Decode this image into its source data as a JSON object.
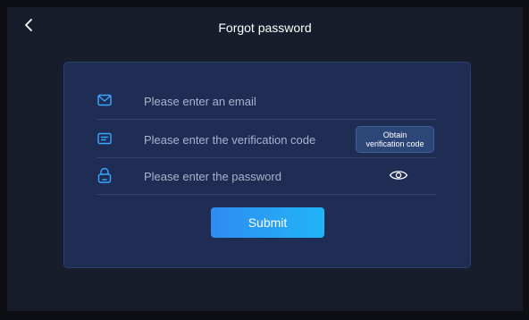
{
  "header": {
    "title": "Forgot password",
    "back_icon": "chevron-left-icon"
  },
  "form": {
    "email": {
      "icon": "mail-icon",
      "placeholder": "Please enter an email",
      "value": ""
    },
    "verification": {
      "icon": "message-icon",
      "placeholder": "Please enter the verification code",
      "value": "",
      "obtain_label": "Obtain\nverification code"
    },
    "password": {
      "icon": "lock-icon",
      "placeholder": "Please enter the password",
      "value": "",
      "toggle_icon": "eye-icon"
    },
    "submit_label": "Submit"
  },
  "colors": {
    "background": "#181d2c",
    "card": "#1f2d55",
    "accent": "#2f8cf0",
    "icon": "#38a8ff"
  }
}
